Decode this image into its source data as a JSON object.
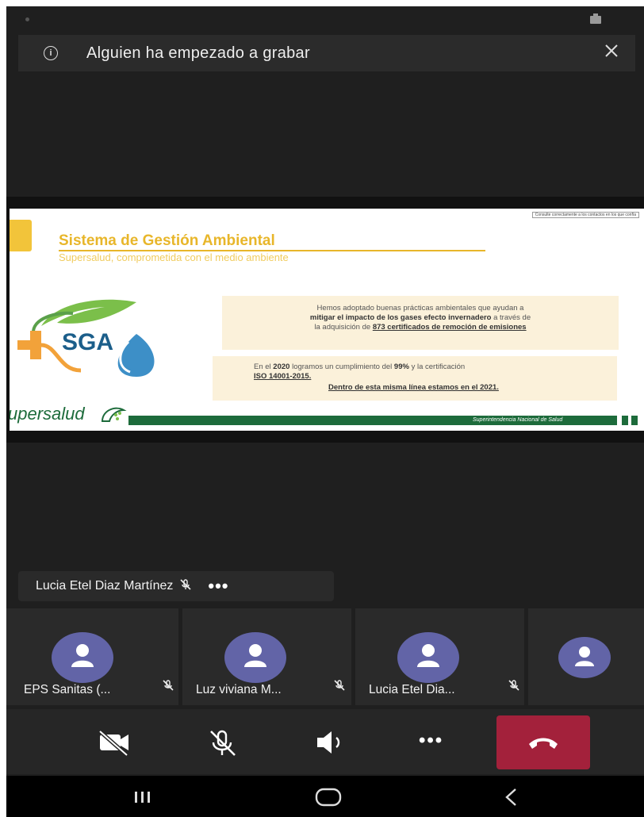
{
  "banner": {
    "text": "Alguien ha empezado a grabar"
  },
  "slide": {
    "top_note": "Consulte correctamente a los contactos en los que confía",
    "title": "Sistema de Gestión Ambiental",
    "subtitle": "Supersalud, comprometida con el medio ambiente",
    "sga_label": "SGA",
    "box1": {
      "line1": "Hemos adoptado buenas prácticas ambientales que ayudan a",
      "line2_bold": "mitigar el impacto de los gases efecto invernadero",
      "line2_rest": " a través de",
      "line3_start": "la adquisición de ",
      "line3_bold": "873 certificados de remoción de emisiones"
    },
    "box2": {
      "l1a": "En el ",
      "l1b": "2020",
      "l1c": " logramos un cumplimiento del ",
      "l1d": "99%",
      "l1e": " y la certificación",
      "l2": "ISO 14001-2015.",
      "l3": "Dentro de esta misma línea estamos en el 2021."
    },
    "brand": "upersalud",
    "footer_text": "Superintendencia Nacional de Salud"
  },
  "speaker": {
    "name": "Lucia Etel Diaz Martínez",
    "more": "•••"
  },
  "participants": [
    {
      "name": "EPS Sanitas (..."
    },
    {
      "name": "Luz viviana M..."
    },
    {
      "name": "Lucia Etel Dia..."
    },
    {
      "name": ""
    }
  ],
  "controls": {
    "camera_icon": "camera-off-icon",
    "mic_icon": "mic-off-icon",
    "speaker_icon": "speaker-icon",
    "more_icon": "more-icon",
    "hangup_icon": "hangup-icon",
    "more_label": "•••"
  },
  "colors": {
    "avatar": "#6264a7",
    "hangup": "#a3213b",
    "accent": "#e8b62a",
    "brand_green": "#1d6b3b"
  }
}
